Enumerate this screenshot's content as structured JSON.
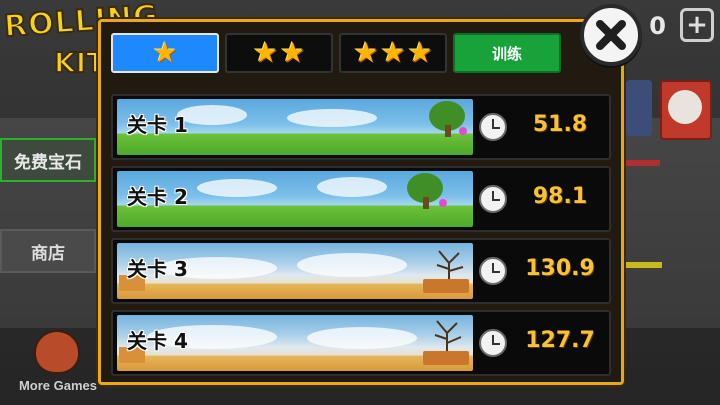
{
  "background": {
    "logo_line1": "ROLLING",
    "logo_line2": "KITTY",
    "free_gems_button": "免费宝石",
    "shop_button": "商店",
    "more_games": "More Games",
    "gem_count": "0",
    "plus": "+"
  },
  "modal": {
    "tabs": [
      {
        "stars": 1,
        "label": "★"
      },
      {
        "stars": 2,
        "label": "★★"
      },
      {
        "stars": 3,
        "label": "★★★"
      },
      {
        "label": "训练"
      }
    ],
    "active_tab": 0,
    "levels": [
      {
        "name": "关卡 1",
        "time": "51.8",
        "scene": "grass"
      },
      {
        "name": "关卡 2",
        "time": "98.1",
        "scene": "grass"
      },
      {
        "name": "关卡 3",
        "time": "130.9",
        "scene": "desert"
      },
      {
        "name": "关卡 4",
        "time": "127.7",
        "scene": "desert"
      }
    ]
  },
  "colors": {
    "accent_gold": "#e9a81a",
    "tab_active": "#1e88ff",
    "train_green": "#17a33a",
    "time_text": "#f7c23a"
  },
  "icons": [
    "star-icon",
    "clock-icon",
    "close-icon"
  ]
}
